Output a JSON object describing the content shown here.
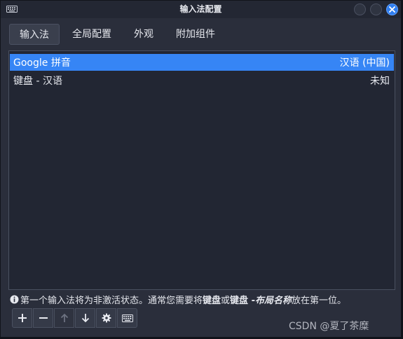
{
  "window": {
    "title": "输入法配置"
  },
  "tabs": [
    {
      "label": "输入法",
      "active": true
    },
    {
      "label": "全局配置",
      "active": false
    },
    {
      "label": "外观",
      "active": false
    },
    {
      "label": "附加组件",
      "active": false
    }
  ],
  "input_methods": [
    {
      "name": "Google 拼音",
      "language": "汉语 (中国)",
      "selected": true
    },
    {
      "name": "键盘 - 汉语",
      "language": "未知",
      "selected": false
    }
  ],
  "info": {
    "prefix": "第一个输入法将为非激活状态。通常您需要将",
    "bold1": "键盘",
    "middle": "或",
    "bold2": "键盘 - ",
    "italic": "布局名称",
    "suffix": "放在第一位。"
  },
  "toolbar": {
    "add": "add-icon",
    "remove": "remove-icon",
    "up": "arrow-up-icon",
    "down": "arrow-down-icon",
    "configure": "gear-icon",
    "keyboard": "keyboard-icon"
  },
  "watermark": "CSDN @夏了茶糜",
  "colors": {
    "accent": "#3685f5",
    "close": "#2f7ef0",
    "background": "#2a2e3b"
  }
}
